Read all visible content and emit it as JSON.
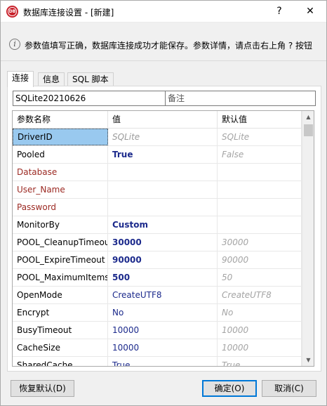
{
  "window": {
    "title": "数据库连接设置 - [新建]",
    "help_glyph": "?",
    "close_glyph": "✕",
    "app_icon_text": "DB"
  },
  "info": {
    "text": "参数值填写正确，数据库连接成功才能保存。参数详情，请点击右上角 ? 按钮"
  },
  "tabs": [
    {
      "label": "连接",
      "active": true
    },
    {
      "label": "信息",
      "active": false
    },
    {
      "label": "SQL 脚本",
      "active": false
    }
  ],
  "connection": {
    "name_value": "SQLite20210626",
    "note_placeholder": "备注"
  },
  "grid": {
    "headers": [
      "参数名称",
      "值",
      "默认值"
    ],
    "rows": [
      {
        "name": "DriverID",
        "value": "SQLite",
        "default": "SQLite",
        "name_style": "normal",
        "value_style": "gray",
        "selected": true
      },
      {
        "name": "Pooled",
        "value": "True",
        "default": "False",
        "name_style": "normal",
        "value_style": "bold"
      },
      {
        "name": "Database",
        "value": "",
        "default": "",
        "name_style": "red",
        "value_style": "blue"
      },
      {
        "name": "User_Name",
        "value": "",
        "default": "",
        "name_style": "red",
        "value_style": "blue"
      },
      {
        "name": "Password",
        "value": "",
        "default": "",
        "name_style": "red",
        "value_style": "blue"
      },
      {
        "name": "MonitorBy",
        "value": "Custom",
        "default": "",
        "name_style": "normal",
        "value_style": "bold"
      },
      {
        "name": "POOL_CleanupTimeout",
        "value": "30000",
        "default": "30000",
        "name_style": "normal",
        "value_style": "bold"
      },
      {
        "name": "POOL_ExpireTimeout",
        "value": "90000",
        "default": "90000",
        "name_style": "normal",
        "value_style": "bold"
      },
      {
        "name": "POOL_MaximumItems",
        "value": "500",
        "default": "50",
        "name_style": "normal",
        "value_style": "bold"
      },
      {
        "name": "OpenMode",
        "value": "CreateUTF8",
        "default": "CreateUTF8",
        "name_style": "normal",
        "value_style": "blue"
      },
      {
        "name": "Encrypt",
        "value": "No",
        "default": "No",
        "name_style": "normal",
        "value_style": "blue"
      },
      {
        "name": "BusyTimeout",
        "value": "10000",
        "default": "10000",
        "name_style": "normal",
        "value_style": "blue"
      },
      {
        "name": "CacheSize",
        "value": "10000",
        "default": "10000",
        "name_style": "normal",
        "value_style": "blue"
      },
      {
        "name": "SharedCache",
        "value": "True",
        "default": "True",
        "name_style": "normal",
        "value_style": "blue"
      }
    ]
  },
  "buttons": {
    "reset": "恢复默认(D)",
    "ok": "确定(O)",
    "cancel": "取消(C)"
  },
  "colors": {
    "selection": "#99c9ef",
    "required_name": "#9c2a23",
    "value_blue": "#1c2a8c",
    "focus_border": "#0078d7"
  }
}
